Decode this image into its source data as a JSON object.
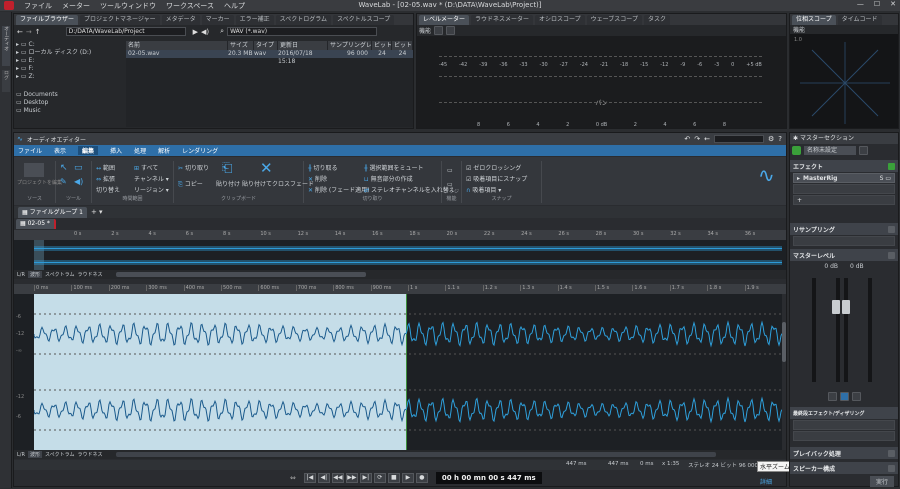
{
  "menubar": {
    "items": [
      "ファイル",
      "メーター",
      "ツールウィンドウ",
      "ワークスペース",
      "ヘルプ"
    ],
    "title": "WaveLab - [02-05.wav * (D:\\DATA\\WaveLab\\Project)]"
  },
  "left_side": {
    "tab_a": "オーディオ",
    "tab_b": "ログ"
  },
  "browser": {
    "tabs": [
      "ファイルブラウザー",
      "プロジェクトマネージャー",
      "メタデータ",
      "マーカー",
      "エラー補正",
      "スペクトログラム",
      "スペクトルスコープ"
    ],
    "path": "D:/DATA/WaveLab/Project",
    "filter": "WAV (*.wav)",
    "drives": [
      "C:",
      "ローカル ディスク (D:)",
      "E:",
      "F:",
      "Z:"
    ],
    "folders": [
      "Documents",
      "Desktop",
      "Music"
    ],
    "columns": [
      "名前",
      "サイズ",
      "タイプ",
      "更新日",
      "サンプリングレート",
      "ビット",
      "ビット"
    ],
    "file": {
      "name": "02-05.wav",
      "size": "20.3 MB",
      "type": "wav",
      "date": "2016/07/18 15:18",
      "rate": "96 000",
      "bits": "24",
      "bits2": "24"
    }
  },
  "meter": {
    "tabs": [
      "レベルメーター",
      "ラウドネスメーター",
      "オシロスコープ",
      "ウェーブスコープ",
      "タスク"
    ],
    "sub": "機能",
    "scale": [
      "-45",
      "-42",
      "-39",
      "-36",
      "-33",
      "-30",
      "-27",
      "-24",
      "-21",
      "-18",
      "-15",
      "-12",
      "-9",
      "-6",
      "-3",
      "0",
      "+5 dB"
    ],
    "pan_label": "パン",
    "bottom": [
      "8",
      "6",
      "4",
      "2",
      "0 dB",
      "2",
      "4",
      "6",
      "8"
    ]
  },
  "scope": {
    "tabs": [
      "位相スコープ",
      "タイムコード"
    ],
    "sub": "機能",
    "corner": "1.0"
  },
  "editor": {
    "title": "オーディオエディター",
    "ribbon_tabs": [
      "ファイル",
      "表示",
      "編集",
      "挿入",
      "処理",
      "解析",
      "レンダリング"
    ],
    "active_ribbon_tab": "編集",
    "groups": [
      {
        "label": "ソース"
      },
      {
        "label": "ツール"
      },
      {
        "label": "時間範囲"
      },
      {
        "label": "クリップボード"
      },
      {
        "label": "切り取り"
      },
      {
        "label": "ナッジ機能"
      },
      {
        "label": "スナップ"
      }
    ],
    "ribbon": {
      "edit_project": "プロジェクトを編集",
      "range": "範囲",
      "all": "すべて",
      "extend": "拡張",
      "channel": "チャンネル",
      "toggle_sel": "切り替え",
      "region": "リージョン",
      "cut": "切り取り",
      "copy": "コピー",
      "paste": "貼り付け",
      "paste_cross": "貼り付けてクロスフェード",
      "trim": "切り取る",
      "delete": "削除",
      "delete_fade": "削除 (フェード適用)",
      "mute_sel": "選択範囲をミュート",
      "silence": "無音部分の作成",
      "swap_ch": "ステレオチャンネルを入れ替え",
      "zero_cross": "ゼロクロッシング",
      "snap_mag": "吸着項目にスナップ",
      "snap_items": "吸着項目"
    },
    "file_group_tab": "ファイルグループ 1",
    "wave_tab": "02-05 *",
    "overview_ticks": [
      "0 s",
      "2 s",
      "4 s",
      "6 s",
      "8 s",
      "10 s",
      "12 s",
      "14 s",
      "16 s",
      "18 s",
      "20 s",
      "22 s",
      "24 s",
      "26 s",
      "28 s",
      "30 s",
      "32 s",
      "34 s",
      "36 s"
    ],
    "view_tabs": [
      "波形",
      "スペクトラム",
      "ラウドネス"
    ],
    "lr": "L/R",
    "main_ticks": [
      "0 ms",
      "100 ms",
      "200 ms",
      "300 ms",
      "400 ms",
      "500 ms",
      "600 ms",
      "700 ms",
      "800 ms",
      "900 ms",
      "1 s",
      "1.1 s",
      "1.2 s",
      "1.3 s",
      "1.4 s",
      "1.5 s",
      "1.6 s",
      "1.7 s",
      "1.8 s",
      "1.9 s"
    ],
    "db_ticks": [
      "-6",
      "-12",
      "-∞",
      "-12",
      "-6"
    ],
    "status": {
      "a": "447 ms",
      "b": "447 ms",
      "c": "0 ms",
      "zoom": "x 1:35",
      "fmt": "ステレオ 24 ビット 96 000"
    },
    "zoom_tip": "水平ズーム",
    "detail": "詳細"
  },
  "master": {
    "title": "マスターセクション",
    "preset": "名称未設定",
    "effects": "エフェクト",
    "effect_slot": "MasterRig",
    "resampling": "リサンプリング",
    "master_level": "マスターレベル",
    "levels": [
      "0 dB",
      "0 dB"
    ],
    "final": "最終段エフェクト/ディザリング",
    "playback": "プレイバック処理",
    "speaker": "スピーカー構成",
    "render": "実行"
  },
  "transport": {
    "time": "00 h 00 mn 00 s 447 ms"
  },
  "colors": {
    "accent": "#2e9ad8",
    "selection": "#c5dde8",
    "wave_dark": "#1a5a8c",
    "wave_light": "#2ea0dc"
  }
}
